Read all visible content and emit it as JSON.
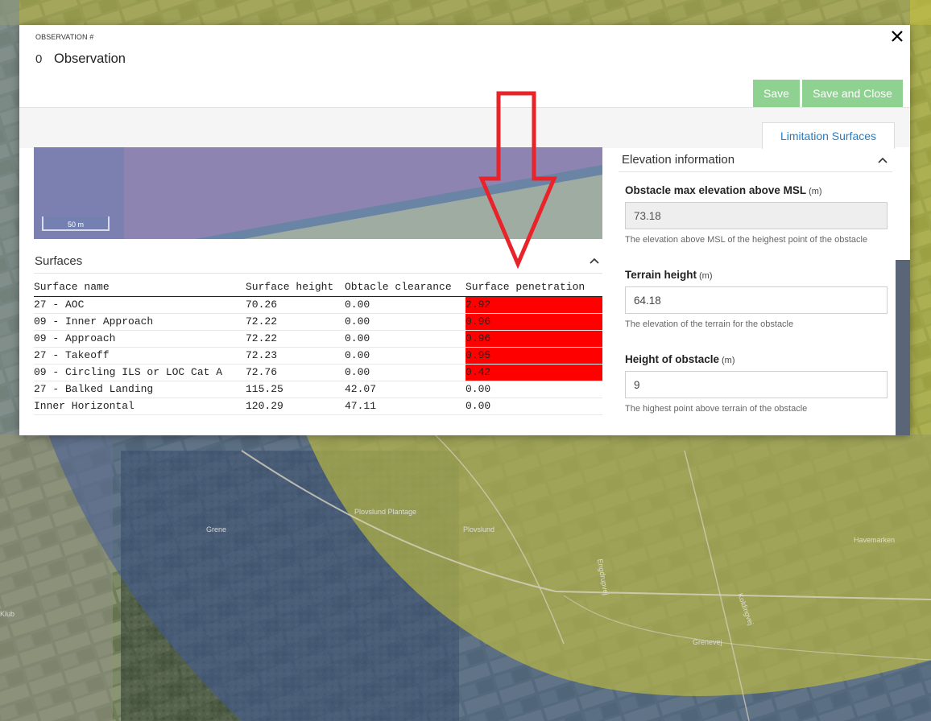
{
  "modal": {
    "observation_label": "OBSERVATION #",
    "observation_number": "0",
    "title": "Observation",
    "save_label": "Save",
    "save_close_label": "Save and Close",
    "tab_label": "Limitation Surfaces",
    "scale_label": "50 m"
  },
  "surfaces": {
    "title": "Surfaces",
    "headers": [
      "Surface name",
      "Surface height",
      "Obtacle clearance",
      "Surface penetration"
    ],
    "rows": [
      {
        "name": "27 - AOC",
        "height": "70.26",
        "clearance": "0.00",
        "penetration": "2.92",
        "penetrates": true
      },
      {
        "name": "09 - Inner Approach",
        "height": "72.22",
        "clearance": "0.00",
        "penetration": "0.96",
        "penetrates": true
      },
      {
        "name": "09 - Approach",
        "height": "72.22",
        "clearance": "0.00",
        "penetration": "0.96",
        "penetrates": true
      },
      {
        "name": "27 - Takeoff",
        "height": "72.23",
        "clearance": "0.00",
        "penetration": "0.95",
        "penetrates": true
      },
      {
        "name": "09 - Circling ILS or LOC Cat A",
        "height": "72.76",
        "clearance": "0.00",
        "penetration": "0.42",
        "penetrates": true
      },
      {
        "name": "27 - Balked Landing",
        "height": "115.25",
        "clearance": "42.07",
        "penetration": "0.00",
        "penetrates": false
      },
      {
        "name": "Inner Horizontal",
        "height": "120.29",
        "clearance": "47.11",
        "penetration": "0.00",
        "penetrates": false
      }
    ]
  },
  "elevation": {
    "title": "Elevation information",
    "max_label": "Obstacle max elevation above MSL",
    "max_unit": "(m)",
    "max_value": "73.18",
    "max_help": "The elevation above MSL of the heighest point of the obstacle",
    "terrain_label": "Terrain height",
    "terrain_unit": "(m)",
    "terrain_value": "64.18",
    "terrain_help": "The elevation of the terrain for the obstacle",
    "height_label": "Height of obstacle",
    "height_unit": "(m)",
    "height_value": "9",
    "height_help": "The highest point above terrain of the obstacle"
  },
  "map_labels": [
    "Grene",
    "Plovslund Plantage",
    "Plovslund",
    "Grenevej",
    "Havemarken",
    "Koldingvej",
    "Engdrupvej",
    "Klub"
  ],
  "colors": {
    "accent": "#2a7bbd",
    "save_button": "#8fd190",
    "penetration_highlight": "#ff0000",
    "annotation_arrow": "#e8232a",
    "surface_yellow": "#c9c43a",
    "surface_blue": "#3f5a9a"
  }
}
